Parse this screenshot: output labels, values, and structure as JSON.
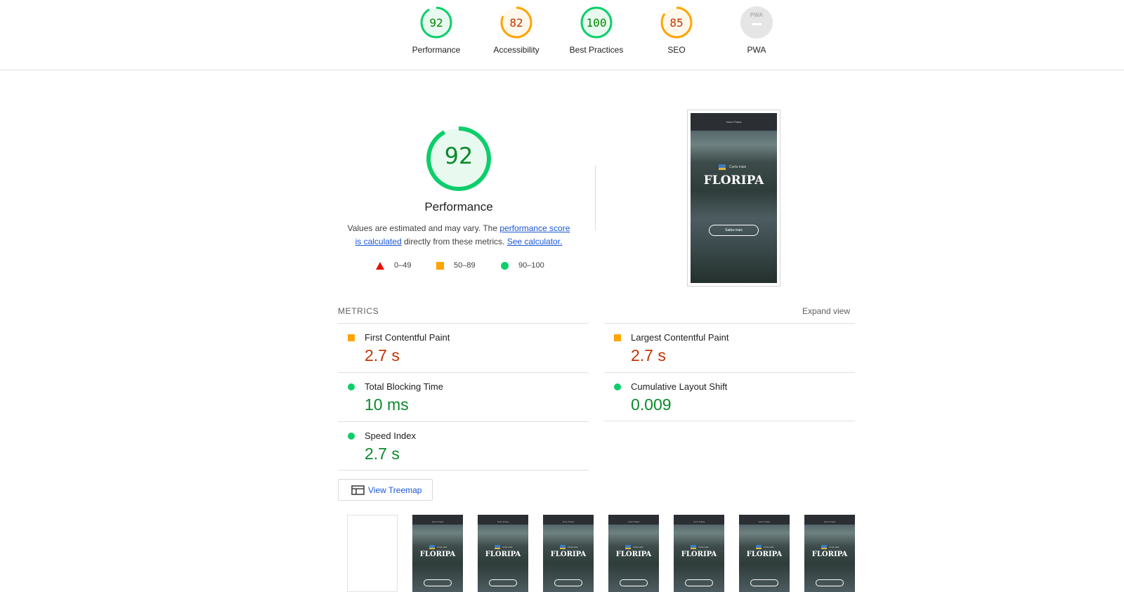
{
  "header": {
    "categories": [
      {
        "score": "92",
        "label": "Performance",
        "color": "#0cce6b",
        "text_color": "#008800",
        "fraction": 0.92
      },
      {
        "score": "82",
        "label": "Accessibility",
        "color": "#ffa400",
        "text_color": "#c33300",
        "fraction": 0.82
      },
      {
        "score": "100",
        "label": "Best Practices",
        "color": "#0cce6b",
        "text_color": "#008800",
        "fraction": 1.0
      },
      {
        "score": "85",
        "label": "SEO",
        "color": "#ffa400",
        "text_color": "#c33300",
        "fraction": 0.85
      },
      {
        "score": "",
        "label": "PWA",
        "badge_text": "PWA"
      }
    ]
  },
  "performance": {
    "score": "92",
    "score_fraction": 0.92,
    "title": "Performance",
    "desc_prefix": "Values are estimated and may vary. The ",
    "desc_link1": "performance score is calculated",
    "desc_middle": " directly from these metrics. ",
    "desc_link2": "See calculator.",
    "legend": {
      "fail": "0–49",
      "average": "50–89",
      "pass": "90–100"
    }
  },
  "screenshot": {
    "nav_text": "Início   Praias",
    "tag_text": "Curta mais",
    "title": "FLORIPA",
    "button": "Saiba mais"
  },
  "metrics": {
    "header": "METRICS",
    "expand": "Expand view",
    "items": [
      {
        "name": "First Contentful Paint",
        "value": "2.7 s",
        "status": "average"
      },
      {
        "name": "Largest Contentful Paint",
        "value": "2.7 s",
        "status": "average"
      },
      {
        "name": "Total Blocking Time",
        "value": "10 ms",
        "status": "pass"
      },
      {
        "name": "Cumulative Layout Shift",
        "value": "0.009",
        "status": "pass"
      },
      {
        "name": "Speed Index",
        "value": "2.7 s",
        "status": "pass"
      }
    ]
  },
  "treemap": {
    "label": "View Treemap"
  },
  "filmstrip": {
    "title": "FLORIPA",
    "frames": 8
  },
  "colors": {
    "pass": "#0cce6b",
    "average": "#ffa400",
    "fail": "#eb0f00",
    "link": "#1a56d6"
  }
}
